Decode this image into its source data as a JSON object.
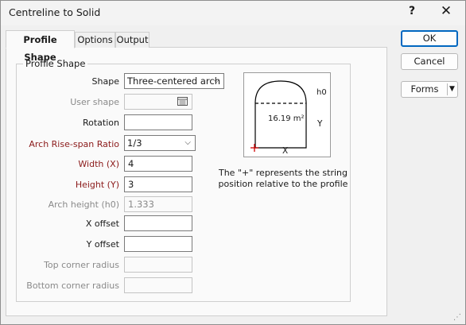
{
  "window": {
    "title": "Centreline to Solid",
    "help_label": "?",
    "close_label": "✕"
  },
  "tabs": [
    {
      "label": "Profile Shape",
      "active": true
    },
    {
      "label": "Options",
      "active": false
    },
    {
      "label": "Output",
      "active": false
    }
  ],
  "group": {
    "title": "Profile Shape"
  },
  "form": {
    "shape": {
      "label": "Shape",
      "value": "Three-centered arch"
    },
    "user_shape": {
      "label": "User shape",
      "value": ""
    },
    "rotation": {
      "label": "Rotation",
      "value": ""
    },
    "arch_ratio": {
      "label": "Arch Rise-span Ratio",
      "value": "1/3"
    },
    "width": {
      "label": "Width (X)",
      "value": "4"
    },
    "height": {
      "label": "Height (Y)",
      "value": "3"
    },
    "arch_height": {
      "label": "Arch height (h0)",
      "value": "1.333"
    },
    "x_offset": {
      "label": "X offset",
      "value": ""
    },
    "y_offset": {
      "label": "Y offset",
      "value": ""
    },
    "top_corner": {
      "label": "Top corner radius",
      "value": ""
    },
    "bottom_corner": {
      "label": "Bottom corner radius",
      "value": ""
    }
  },
  "preview": {
    "area": "16.19 m²",
    "h0": "h0",
    "y": "Y",
    "x": "X"
  },
  "caption": {
    "line1": "The \"+\" represents the string",
    "line2": "position relative to the profile"
  },
  "buttons": {
    "ok": "OK",
    "cancel": "Cancel",
    "forms": "Forms"
  },
  "colors": {
    "required_label": "#8b1a1a",
    "disabled_label": "#8a8a8a",
    "accent": "#0067c0",
    "marker": "#d00000"
  }
}
